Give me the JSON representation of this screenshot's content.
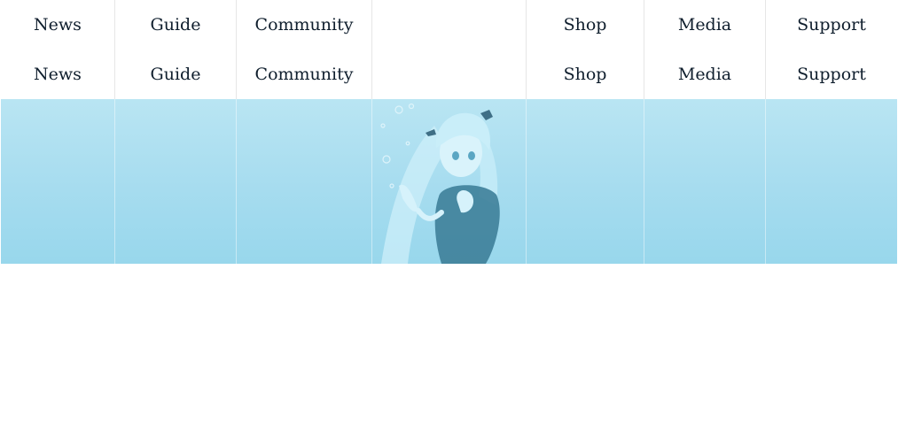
{
  "nav_primary": {
    "items": [
      {
        "label": "News"
      },
      {
        "label": "Guide"
      },
      {
        "label": "Community"
      },
      {
        "label": ""
      },
      {
        "label": "Shop"
      },
      {
        "label": "Media"
      },
      {
        "label": "Support"
      }
    ]
  },
  "nav_secondary": {
    "items": [
      {
        "label": "News"
      },
      {
        "label": "Guide"
      },
      {
        "label": "Community"
      },
      {
        "label": ""
      },
      {
        "label": "Shop"
      },
      {
        "label": "Media"
      },
      {
        "label": "Support"
      }
    ]
  },
  "banner": {
    "illustration": "anime-girl-underwater",
    "colors": {
      "top": "#b9e5f3",
      "bottom": "#98d7ec",
      "text": "#0f1e2d"
    }
  }
}
